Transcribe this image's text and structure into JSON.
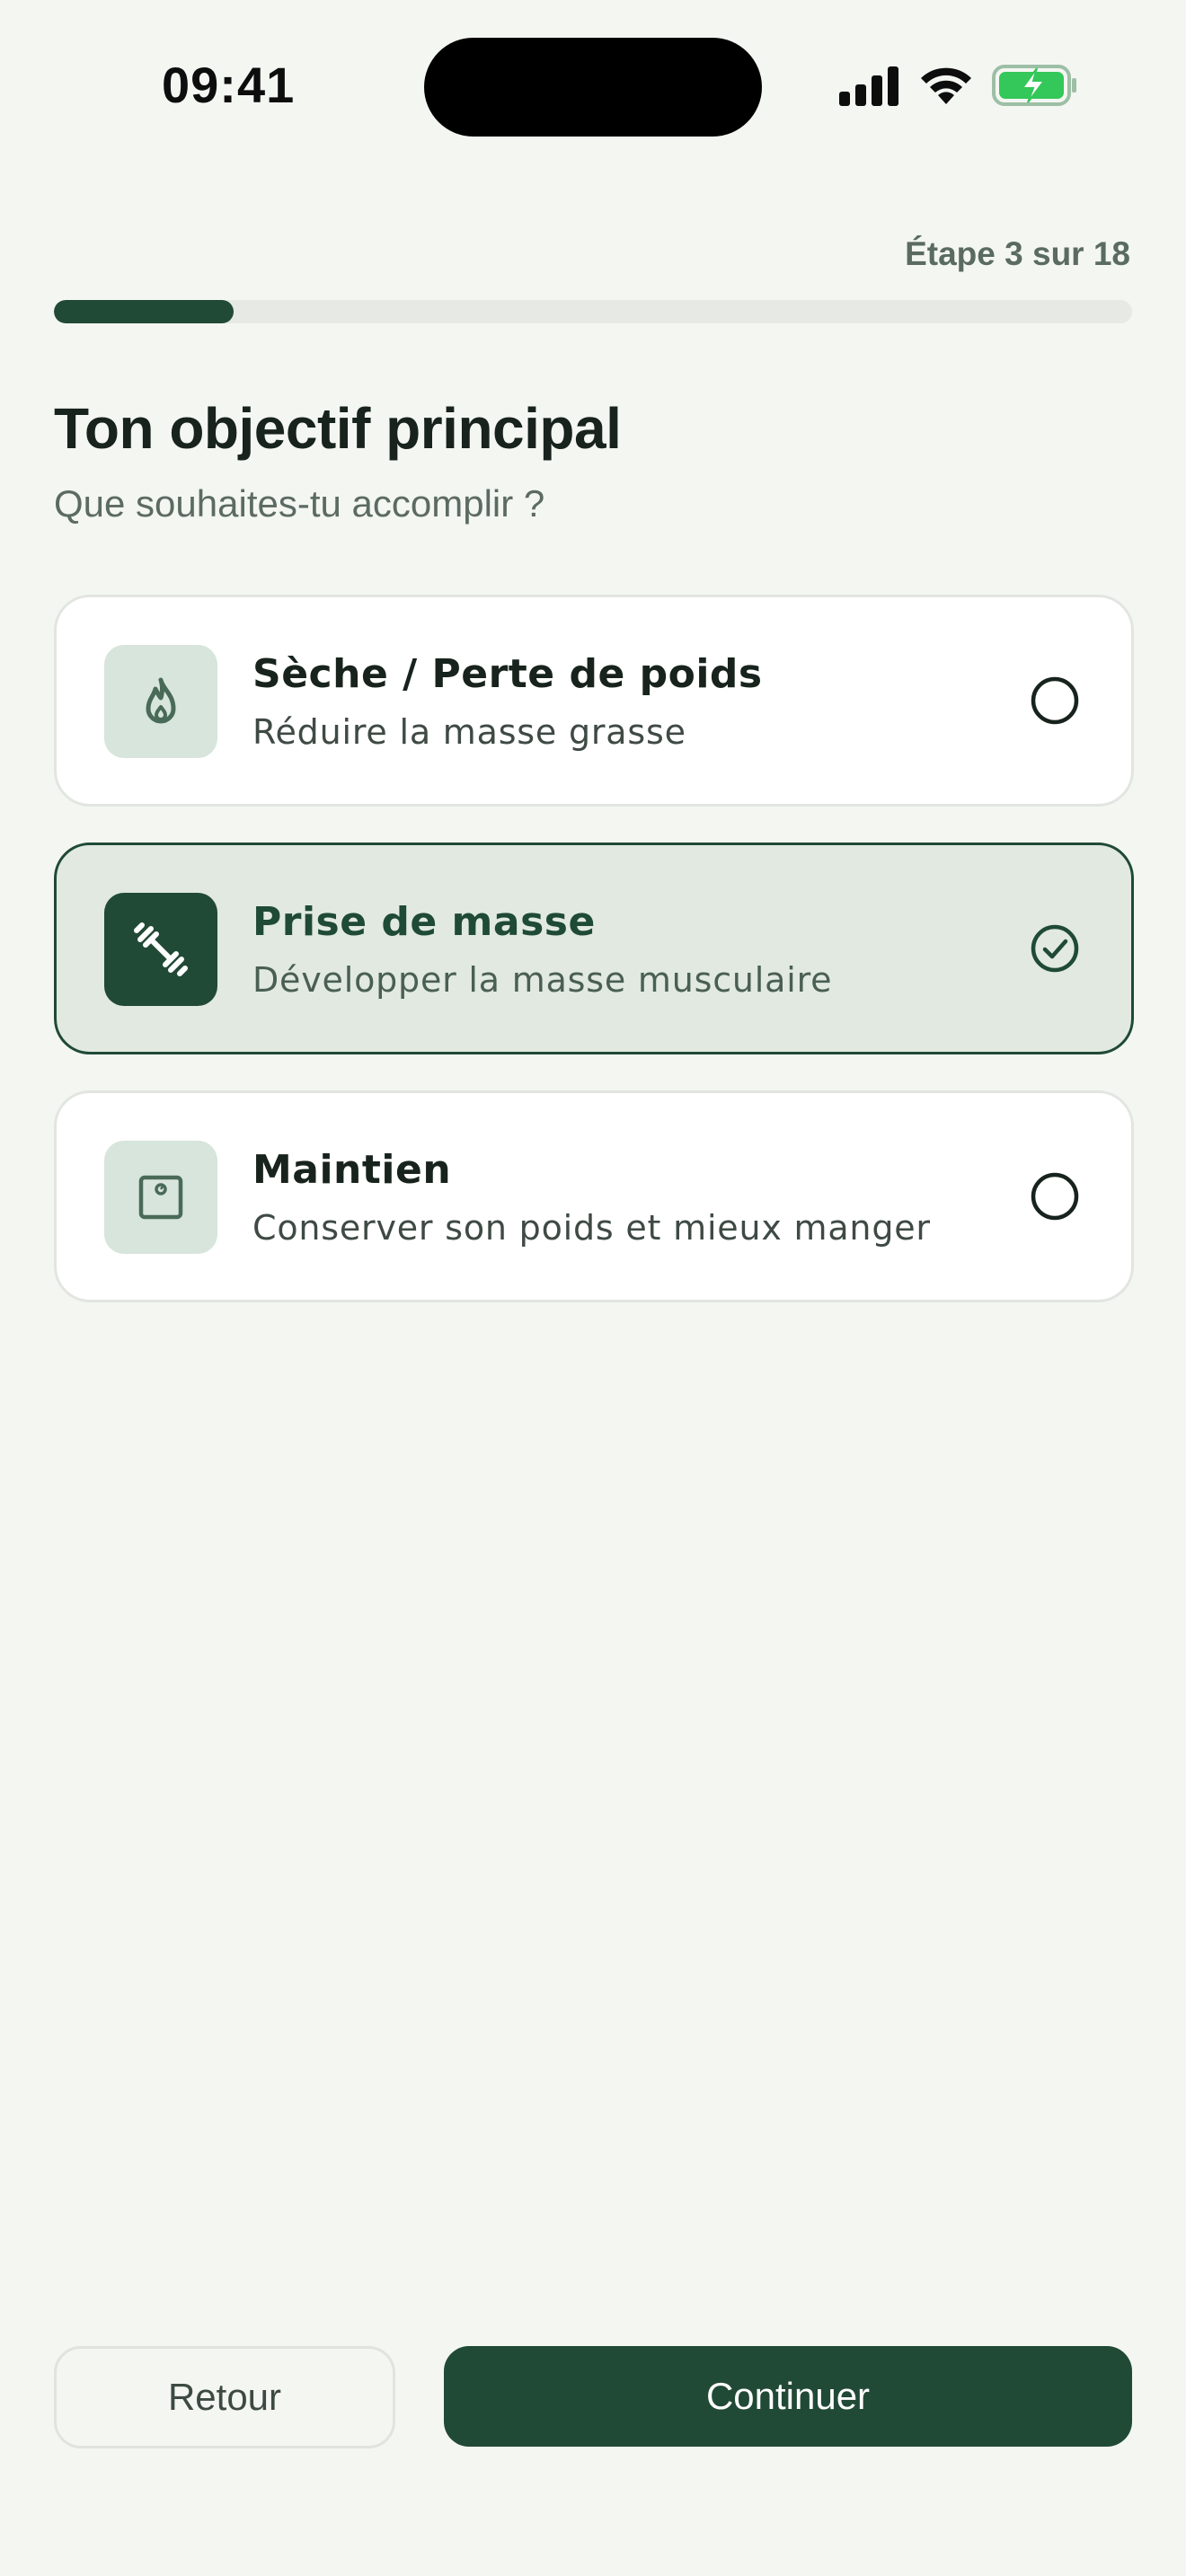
{
  "status_bar": {
    "time": "09:41",
    "icons": [
      "signal-icon",
      "wifi-icon",
      "battery-charging-icon"
    ],
    "battery_color": "#34c759"
  },
  "progress": {
    "label": "Étape 3 sur 18",
    "current": 3,
    "total": 18,
    "fill_color": "#214a36"
  },
  "header": {
    "title": "Ton objectif principal",
    "subtitle": "Que souhaites-tu accomplir ?"
  },
  "options": [
    {
      "title": "Sèche / Perte de poids",
      "description": "Réduire la masse grasse",
      "icon": "flame-icon",
      "selected": false
    },
    {
      "title": "Prise de masse",
      "description": "Développer la masse musculaire",
      "icon": "dumbbell-icon",
      "selected": true
    },
    {
      "title": "Maintien",
      "description": "Conserver son poids et mieux manger",
      "icon": "scale-icon",
      "selected": false
    }
  ],
  "footer": {
    "back_label": "Retour",
    "continue_label": "Continuer"
  },
  "colors": {
    "accent": "#214a36",
    "background": "#f4f6f2",
    "selected_card": "#e1e9e1"
  }
}
